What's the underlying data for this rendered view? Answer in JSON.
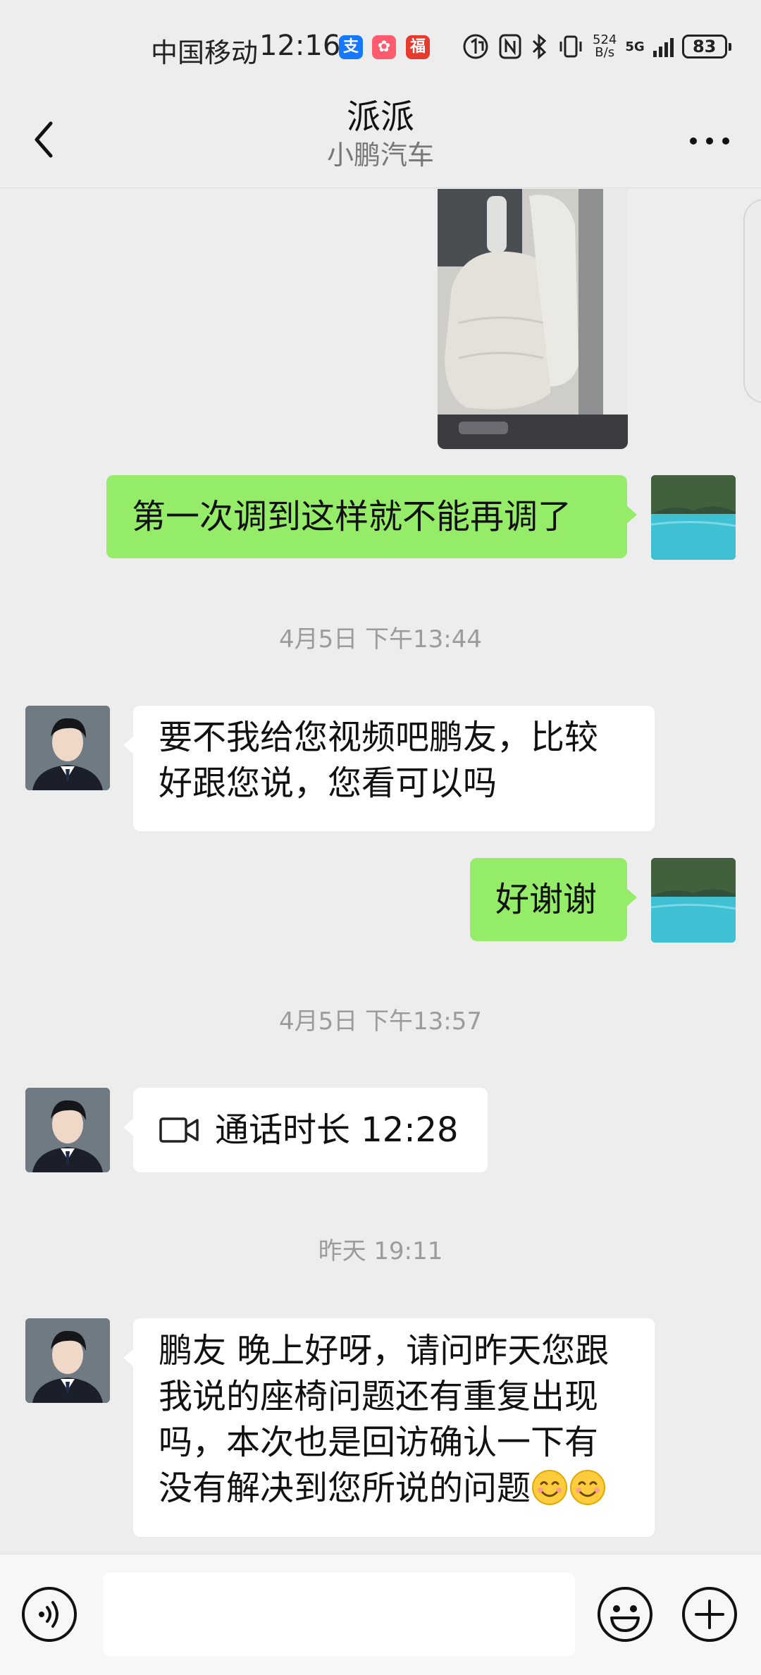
{
  "status_bar": {
    "carrier": "中国移动",
    "time": "12:16",
    "app_icons": [
      {
        "name": "alipay-icon",
        "glyph": "支",
        "color": "#1677ff"
      },
      {
        "name": "game-app-icon",
        "glyph": "✿",
        "color": "#ff5b6e"
      },
      {
        "name": "red-app-icon",
        "glyph": "福",
        "color": "#e63a2e"
      }
    ],
    "net_speed_value": "524",
    "net_speed_unit": "B/s",
    "network": "5G",
    "battery": "83"
  },
  "header": {
    "title": "派派",
    "subtitle": "小鹏汽车"
  },
  "messages": {
    "m1": "第一次调到这样就不能再调了",
    "t1": "4月5日 下午13:44",
    "m2_line1": "要不我给您视频吧鹏友，比较",
    "m2_line2": "好跟您说，您看可以吗",
    "m3": "好谢谢",
    "t2": "4月5日 下午13:57",
    "m4": "通话时长 12:28",
    "t3": "昨天 19:11",
    "m5_line1": "鹏友  晚上好呀，请问昨天您跟",
    "m5_line2": "我说的座椅问题还有重复出现",
    "m5_line3": "吗，本次也是回访确认一下有",
    "m5_line4": "没有解决到您所说的问题"
  },
  "input": {
    "value": "",
    "placeholder": ""
  },
  "colors": {
    "background": "#ededed",
    "sent_bubble": "#95ec69",
    "received_bubble": "#ffffff"
  }
}
